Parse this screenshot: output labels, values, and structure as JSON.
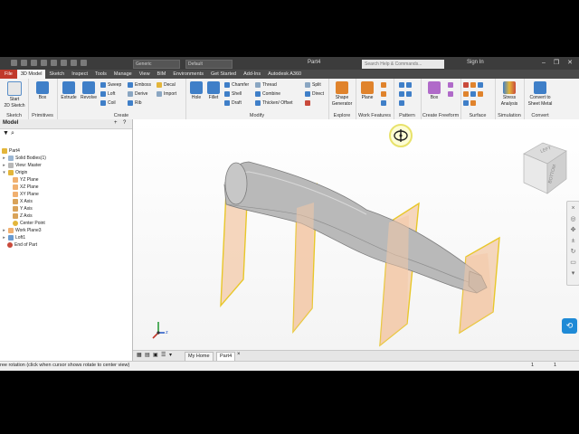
{
  "titlebar": {
    "app_icon": "inventor-logo",
    "style_dropdown": "Generic",
    "appearance_dropdown": "Default",
    "title": "Part4",
    "search_placeholder": "Search Help & Commands...",
    "sign_in": "Sign In",
    "minimize": "–",
    "restore": "❐",
    "close": "✕"
  },
  "menu": {
    "tabs": [
      "File",
      "3D Model",
      "Sketch",
      "Inspect",
      "Tools",
      "Manage",
      "View",
      "BIM",
      "Environments",
      "Get Started",
      "Add-Ins",
      "Autodesk A360"
    ]
  },
  "ribbon": {
    "sketch": {
      "start_line1": "Start",
      "start_line2": "2D Sketch",
      "label": "Sketch"
    },
    "primitives": {
      "box": "Box",
      "label": "Primitives"
    },
    "create": {
      "extrude": "Extrude",
      "revolve": "Revolve",
      "sweep": "Sweep",
      "loft": "Loft",
      "coil": "Coil",
      "emboss": "Emboss",
      "derive": "Derive",
      "rib": "Rib",
      "decal": "Decal",
      "import": "Import",
      "label": "Create"
    },
    "modify": {
      "hole": "Hole",
      "fillet": "Fillet",
      "chamfer": "Chamfer",
      "shell": "Shell",
      "draft": "Draft",
      "thread": "Thread",
      "combine": "Combine",
      "thicken": "Thicken/ Offset",
      "split": "Split",
      "direct": "Direct",
      "delete": "Delete",
      "label": "Modify"
    },
    "explore": {
      "shape_gen_line1": "Shape",
      "shape_gen_line2": "Generator",
      "label": "Explore"
    },
    "work_features": {
      "plane": "Plane",
      "label": "Work Features"
    },
    "pattern": {
      "label": "Pattern"
    },
    "freeform": {
      "box": "Box",
      "label": "Create Freeform"
    },
    "surface": {
      "label": "Surface"
    },
    "simulation": {
      "stress_line1": "Stress",
      "stress_line2": "Analysis",
      "label": "Simulation"
    },
    "convert": {
      "line1": "Convert to",
      "line2": "Sheet Metal",
      "label": "Convert"
    }
  },
  "browser": {
    "title": "Model",
    "items": [
      {
        "label": "Part4",
        "indent": 0
      },
      {
        "label": "Solid Bodies(1)",
        "indent": 1
      },
      {
        "label": "View: Master",
        "indent": 1
      },
      {
        "label": "Origin",
        "indent": 1
      },
      {
        "label": "YZ Plane",
        "indent": 2
      },
      {
        "label": "XZ Plane",
        "indent": 2
      },
      {
        "label": "XY Plane",
        "indent": 2
      },
      {
        "label": "X Axis",
        "indent": 2
      },
      {
        "label": "Y Axis",
        "indent": 2
      },
      {
        "label": "Z Axis",
        "indent": 2
      },
      {
        "label": "Center Point",
        "indent": 2
      },
      {
        "label": "Work Plane3",
        "indent": 1
      },
      {
        "label": "Loft1",
        "indent": 1
      },
      {
        "label": "End of Part",
        "indent": 1
      }
    ]
  },
  "viewcube": {
    "left": "LEFT",
    "bottom": "BOTTOM"
  },
  "triad": {
    "z": "z"
  },
  "doc_tabs": {
    "home": "My Home",
    "part": "Part4"
  },
  "status": {
    "text": "ree rotation (click when cursor shows rotate to center view)",
    "num1": "1",
    "num2": "1"
  },
  "colors": {
    "accent_red": "#c0392b",
    "plane_fill": "#f3c9a8",
    "plane_edge": "#e8c72a",
    "body": "#b9b9b9"
  }
}
